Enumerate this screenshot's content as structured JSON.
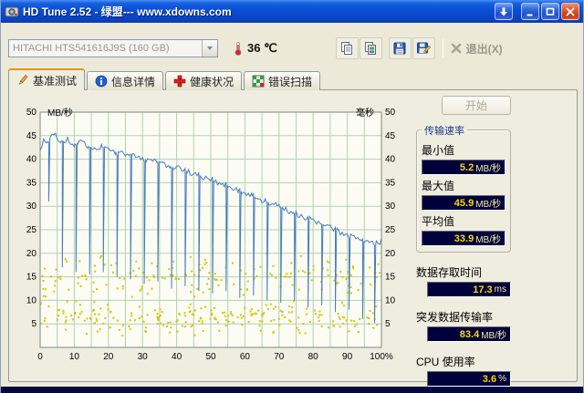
{
  "window": {
    "title": "HD Tune 2.52 - 绿盟--- www.xdowns.com"
  },
  "toolbar": {
    "drive_select": "HITACHI HTS541616J9S (160 GB)",
    "temperature": "36 ℃",
    "exit_label": "退出(X)"
  },
  "tabs": [
    {
      "label": "基准测试",
      "icon": "pencil-icon"
    },
    {
      "label": "信息详情",
      "icon": "info-icon"
    },
    {
      "label": "健康状况",
      "icon": "health-cross-icon"
    },
    {
      "label": "错误扫描",
      "icon": "error-scan-icon"
    }
  ],
  "panel": {
    "start_label": "开始",
    "transfer_group_title": "传输速率",
    "stats": {
      "min": {
        "label": "最小值",
        "value": "5.2",
        "unit": "MB/秒"
      },
      "max": {
        "label": "最大值",
        "value": "45.9",
        "unit": "MB/秒"
      },
      "avg": {
        "label": "平均值",
        "value": "33.9",
        "unit": "MB/秒"
      },
      "access": {
        "label": "数据存取时间",
        "value": "17.3",
        "unit": "ms"
      },
      "burst": {
        "label": "突发数据传输率",
        "value": "83.4",
        "unit": "MB/秒"
      },
      "cpu": {
        "label": "CPU 使用率",
        "value": "3.6",
        "unit": "%"
      }
    }
  },
  "chart_data": {
    "type": "line+scatter",
    "left_axis": {
      "label": "MB/秒",
      "min": 0,
      "max": 50,
      "tick_step": 5
    },
    "right_axis": {
      "label": "毫秒",
      "min": 0,
      "max": 50,
      "tick_step": 5
    },
    "x_axis": {
      "min": 0,
      "max": 100,
      "tick_labels": [
        "0",
        "10",
        "20",
        "30",
        "40",
        "50",
        "60",
        "70",
        "80",
        "90",
        "100%"
      ]
    },
    "grid_step": 5,
    "colors": {
      "plot_bg": "#fcfcf4",
      "grid": "#aed3ae",
      "border": "#7a8a7a",
      "line": "#4a7cc0",
      "scatter": "#d4c400"
    },
    "line": {
      "name": "transfer-rate-mb-s",
      "noise": 1.3,
      "seed": 20,
      "anchors": [
        [
          0,
          41.5
        ],
        [
          1,
          44.2
        ],
        [
          2,
          43.6
        ],
        [
          4,
          45.3
        ],
        [
          6,
          43.8
        ],
        [
          8,
          44
        ],
        [
          10,
          43.2
        ],
        [
          12,
          43.5
        ],
        [
          14,
          42.7
        ],
        [
          16,
          42.4
        ],
        [
          18,
          42.7
        ],
        [
          20,
          41.9
        ],
        [
          22,
          41.4
        ],
        [
          24,
          41.7
        ],
        [
          26,
          40.9
        ],
        [
          28,
          40.4
        ],
        [
          30,
          40.1
        ],
        [
          32,
          39.7
        ],
        [
          34,
          39.4
        ],
        [
          36,
          38.9
        ],
        [
          38,
          38.5
        ],
        [
          40,
          38.1
        ],
        [
          42,
          37.7
        ],
        [
          44,
          37.1
        ],
        [
          46,
          36.7
        ],
        [
          48,
          36.1
        ],
        [
          50,
          35.7
        ],
        [
          52,
          35.1
        ],
        [
          54,
          34.7
        ],
        [
          56,
          34.1
        ],
        [
          58,
          33.5
        ],
        [
          60,
          32.9
        ],
        [
          62,
          32.3
        ],
        [
          64,
          31.7
        ],
        [
          66,
          31.1
        ],
        [
          68,
          30.5
        ],
        [
          70,
          29.9
        ],
        [
          72,
          29.3
        ],
        [
          74,
          28.7
        ],
        [
          76,
          28.1
        ],
        [
          78,
          27.5
        ],
        [
          80,
          26.9
        ],
        [
          82,
          26.3
        ],
        [
          84,
          25.7
        ],
        [
          86,
          25.1
        ],
        [
          88,
          24.5
        ],
        [
          90,
          23.9
        ],
        [
          92,
          23.3
        ],
        [
          94,
          22.7
        ],
        [
          96,
          22.3
        ],
        [
          98,
          21.9
        ],
        [
          100,
          22.6
        ]
      ],
      "dips": [
        [
          2.5,
          31
        ],
        [
          6.5,
          17
        ],
        [
          10.5,
          16
        ],
        [
          14.5,
          15.5
        ],
        [
          18.5,
          16
        ],
        [
          22.5,
          15
        ],
        [
          26.5,
          14.5
        ],
        [
          30.5,
          13.5
        ],
        [
          34.5,
          14
        ],
        [
          38.5,
          12.5
        ],
        [
          42.5,
          13
        ],
        [
          46.5,
          12
        ],
        [
          50.5,
          11.5
        ],
        [
          54.5,
          12
        ],
        [
          58.5,
          10.5
        ],
        [
          62.5,
          11
        ],
        [
          66.5,
          10
        ],
        [
          70.5,
          9.5
        ],
        [
          74.5,
          10
        ],
        [
          78.5,
          8.5
        ],
        [
          82.5,
          9
        ],
        [
          86.5,
          7.5
        ],
        [
          90.5,
          8
        ],
        [
          94.5,
          6
        ],
        [
          98,
          5.2
        ]
      ]
    },
    "scatter": {
      "name": "access-time-ms",
      "count": 400,
      "seed": 77,
      "clusters": [
        {
          "weight": 0.55,
          "mean": 6,
          "spread": 4
        },
        {
          "weight": 0.45,
          "mean": 15,
          "spread": 5
        }
      ],
      "y_min": 1.5,
      "y_max": 26
    },
    "stats": {
      "transfer_min_mb_s": 5.2,
      "transfer_max_mb_s": 45.9,
      "transfer_avg_mb_s": 33.9,
      "access_time_ms": 17.3,
      "burst_rate_mb_s": 83.4,
      "cpu_usage_pct": 3.6
    }
  }
}
